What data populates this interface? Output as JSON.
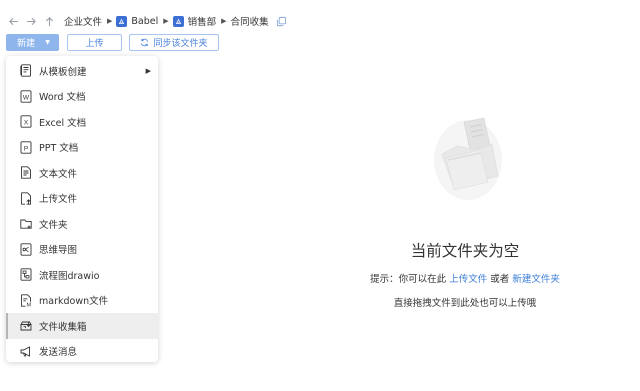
{
  "breadcrumb": {
    "items": [
      {
        "label": "企业文件",
        "icon": null
      },
      {
        "label": "Babel",
        "icon": "space-icon"
      },
      {
        "label": "销售部",
        "icon": "space-icon"
      },
      {
        "label": "合同收集",
        "icon": null
      }
    ]
  },
  "toolbar": {
    "new_label": "新建",
    "upload_label": "上传",
    "sync_label": "同步该文件夹"
  },
  "menu": {
    "items": [
      {
        "label": "从模板创建",
        "icon": "template-icon",
        "has_submenu": true
      },
      {
        "label": "Word 文档",
        "icon": "word-doc-icon",
        "letter": "W"
      },
      {
        "label": "Excel 文档",
        "icon": "excel-doc-icon",
        "letter": "X"
      },
      {
        "label": "PPT 文档",
        "icon": "ppt-doc-icon",
        "letter": "P"
      },
      {
        "label": "文本文件",
        "icon": "text-file-icon"
      },
      {
        "label": "上传文件",
        "icon": "upload-file-icon"
      },
      {
        "label": "文件夹",
        "icon": "folder-icon"
      },
      {
        "label": "思维导图",
        "icon": "mindmap-icon"
      },
      {
        "label": "流程图drawio",
        "icon": "flowchart-icon"
      },
      {
        "label": "markdown文件",
        "icon": "markdown-icon",
        "letter": "M"
      },
      {
        "label": "文件收集箱",
        "icon": "collect-box-icon",
        "active": true
      },
      {
        "label": "发送消息",
        "icon": "megaphone-icon"
      }
    ]
  },
  "empty": {
    "title": "当前文件夹为空",
    "tip_prefix": "提示：你可以在此",
    "tip_link_upload": "上传文件",
    "tip_middle": "或者",
    "tip_link_new_folder": "新建文件夹",
    "sub": "直接拖拽文件到此处也可以上传哦"
  },
  "colors": {
    "primary": "#4a83dc",
    "primary_light": "#8fb6ec",
    "space_icon": "#3b6fd4"
  }
}
